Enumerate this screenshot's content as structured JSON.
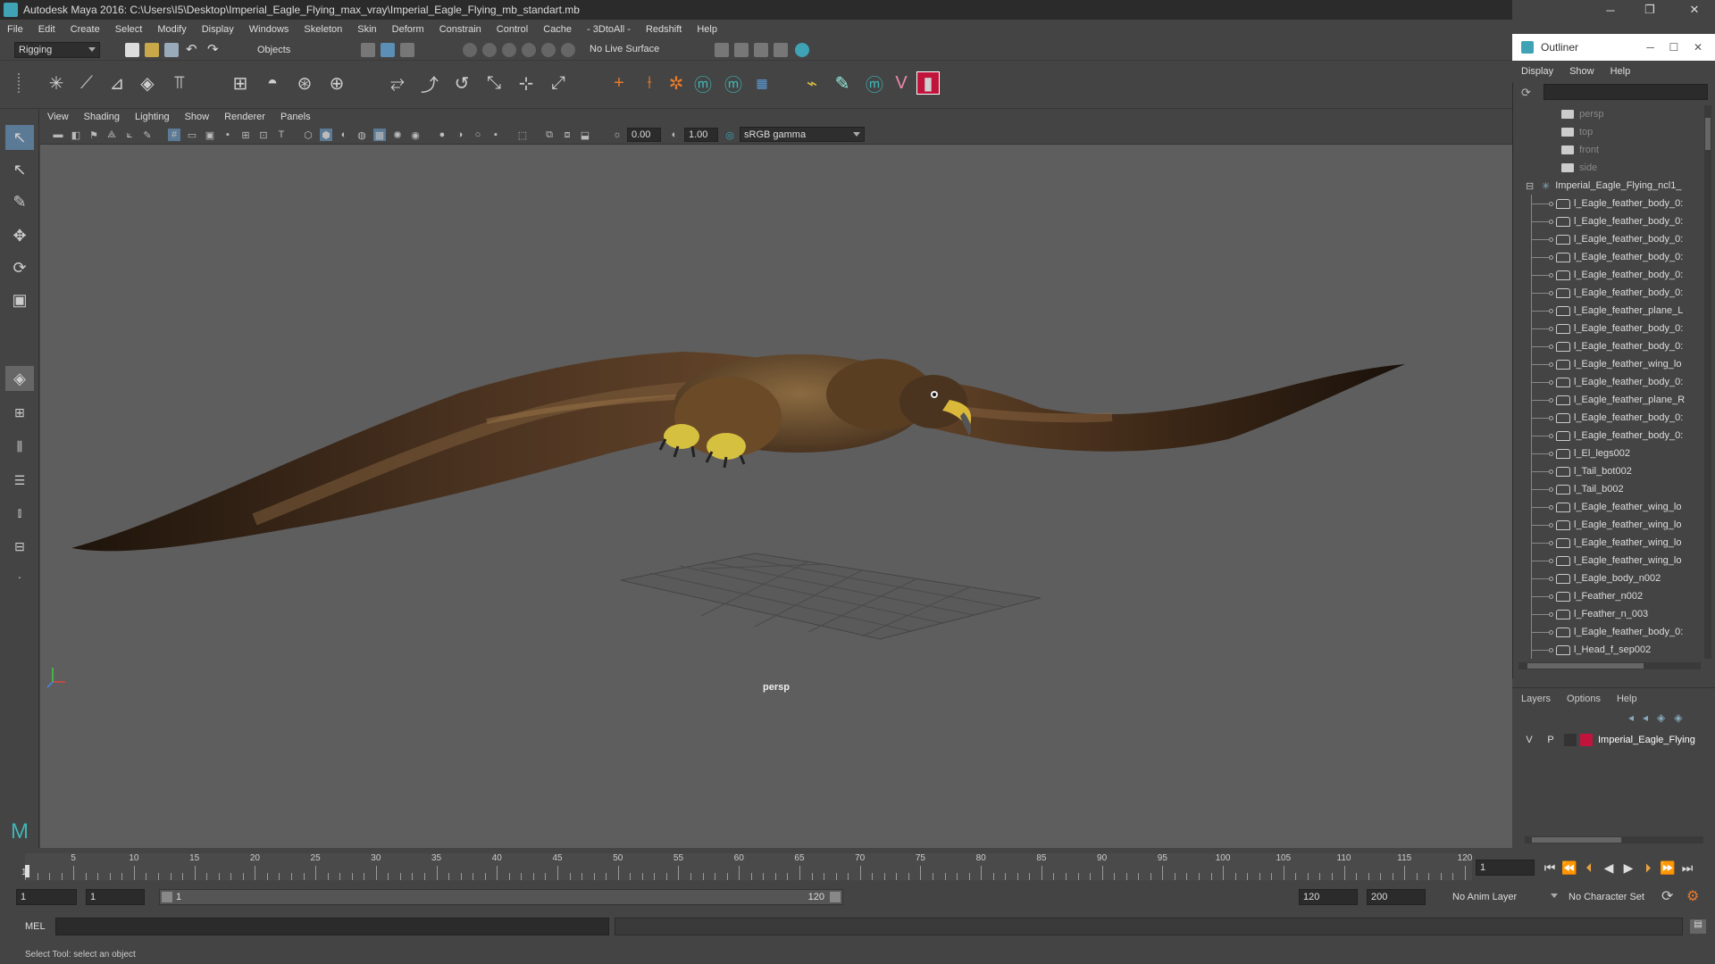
{
  "window": {
    "title": "Autodesk Maya 2016: C:\\Users\\I5\\Desktop\\Imperial_Eagle_Flying_max_vray\\Imperial_Eagle_Flying_mb_standart.mb",
    "min": "─",
    "max": "❐",
    "close": "✕"
  },
  "menus": [
    "File",
    "Edit",
    "Create",
    "Select",
    "Modify",
    "Display",
    "Windows",
    "Skeleton",
    "Skin",
    "Deform",
    "Constrain",
    "Control",
    "Cache",
    "- 3DtoAll -",
    "Redshift",
    "Help"
  ],
  "statusline": {
    "mode": "Rigging",
    "select_mode": "Objects",
    "live_surface": "No Live Surface"
  },
  "panel_menu": [
    "View",
    "Shading",
    "Lighting",
    "Show",
    "Renderer",
    "Panels"
  ],
  "panel_toolbar": {
    "exposure": "0.00",
    "gamma": "1.00",
    "colorspace": "sRGB gamma"
  },
  "viewport": {
    "camera_label": "persp"
  },
  "outliner": {
    "title": "Outliner",
    "menu": [
      "Display",
      "Show",
      "Help"
    ],
    "items": [
      {
        "label": "persp",
        "type": "camera",
        "dim": true
      },
      {
        "label": "top",
        "type": "camera",
        "dim": true
      },
      {
        "label": "front",
        "type": "camera",
        "dim": true
      },
      {
        "label": "side",
        "type": "camera",
        "dim": true
      },
      {
        "label": "Imperial_Eagle_Flying_ncl1_",
        "type": "group"
      },
      {
        "label": "l_Eagle_feather_body_0:",
        "type": "mesh"
      },
      {
        "label": "l_Eagle_feather_body_0:",
        "type": "mesh"
      },
      {
        "label": "l_Eagle_feather_body_0:",
        "type": "mesh"
      },
      {
        "label": "l_Eagle_feather_body_0:",
        "type": "mesh"
      },
      {
        "label": "l_Eagle_feather_body_0:",
        "type": "mesh"
      },
      {
        "label": "l_Eagle_feather_body_0:",
        "type": "mesh"
      },
      {
        "label": "l_Eagle_feather_plane_L",
        "type": "mesh"
      },
      {
        "label": "l_Eagle_feather_body_0:",
        "type": "mesh"
      },
      {
        "label": "l_Eagle_feather_body_0:",
        "type": "mesh"
      },
      {
        "label": "l_Eagle_feather_wing_lo",
        "type": "mesh"
      },
      {
        "label": "l_Eagle_feather_body_0:",
        "type": "mesh"
      },
      {
        "label": "l_Eagle_feather_plane_R",
        "type": "mesh"
      },
      {
        "label": "l_Eagle_feather_body_0:",
        "type": "mesh"
      },
      {
        "label": "l_Eagle_feather_body_0:",
        "type": "mesh"
      },
      {
        "label": "l_El_legs002",
        "type": "mesh"
      },
      {
        "label": "l_Tail_bot002",
        "type": "mesh"
      },
      {
        "label": "l_Tail_b002",
        "type": "mesh"
      },
      {
        "label": "l_Eagle_feather_wing_lo",
        "type": "mesh"
      },
      {
        "label": "l_Eagle_feather_wing_lo",
        "type": "mesh"
      },
      {
        "label": "l_Eagle_feather_wing_lo",
        "type": "mesh"
      },
      {
        "label": "l_Eagle_feather_wing_lo",
        "type": "mesh"
      },
      {
        "label": "l_Eagle_body_n002",
        "type": "mesh"
      },
      {
        "label": "l_Feather_n002",
        "type": "mesh"
      },
      {
        "label": "l_Feather_n_003",
        "type": "mesh"
      },
      {
        "label": "l_Eagle_feather_body_0:",
        "type": "mesh"
      },
      {
        "label": "l_Head_f_sep002",
        "type": "mesh"
      }
    ]
  },
  "layers": {
    "menu": [
      "Layers",
      "Options",
      "Help"
    ],
    "v": "V",
    "p": "P",
    "layer_name": "Imperial_Eagle_Flying",
    "layer_color": "#c0143c"
  },
  "timeline": {
    "ticks": [
      "5",
      "10",
      "15",
      "20",
      "25",
      "30",
      "35",
      "40",
      "45",
      "50",
      "55",
      "60",
      "65",
      "70",
      "75",
      "80",
      "85",
      "90",
      "95",
      "100",
      "105",
      "110",
      "115",
      "120"
    ],
    "start_label": "1",
    "current_frame": "1"
  },
  "range": {
    "start": "1",
    "anim_start": "1",
    "slider_start": "1",
    "slider_end": "120",
    "anim_end": "120",
    "end": "200",
    "anim_layer": "No Anim Layer",
    "char_set": "No Character Set"
  },
  "cmd": {
    "lang": "MEL"
  },
  "help_line": "Select Tool: select an object"
}
